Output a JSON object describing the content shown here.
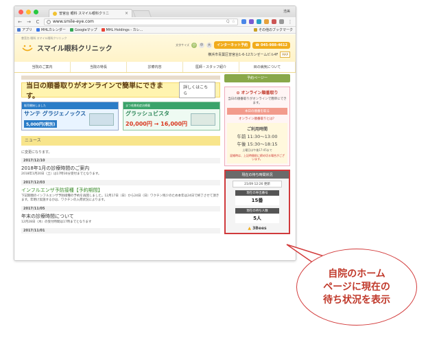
{
  "browser": {
    "tab_title": "曽宮台 眼科 スマイル眼科クリニ",
    "tab_close": "×",
    "profile": "浩美",
    "nav_back": "←",
    "nav_forward": "→",
    "nav_reload": "C",
    "url": "www.smile-eye.com",
    "omni_search": "Q",
    "omni_star": "☆",
    "menu": "⋮",
    "bookmarks": [
      {
        "label": "アプリ",
        "color": "#4a7bd0"
      },
      {
        "label": "MHLカレンダー",
        "color": "#3b78e7"
      },
      {
        "label": "Googleマップ",
        "color": "#34a853"
      },
      {
        "label": "MHL Holdings - カレ...",
        "color": "#ea4335"
      }
    ],
    "other_bookmarks": "その他のブックマーク"
  },
  "site": {
    "breadcrumb": "曽宮台 眼科 スマイル眼科クリニック",
    "clinic_name": "スマイル眼科クリニック",
    "font_size_label": "文字サイズ",
    "font_size_buttons": [
      "小",
      "中",
      "大"
    ],
    "reserve_button": "インターネット予約",
    "phone": "☎ 045-988-4612",
    "address": "横浜市青葉区曽宮台1-6-12カンゼームビル4F",
    "map_button": "MAP",
    "nav": [
      "当院のご案内",
      "当院の特長",
      "診療内容",
      "医師・スタッフ紹介",
      "目の病気について"
    ]
  },
  "main": {
    "banner_title": "当日の順番取りがオンラインで簡単にできます。",
    "banner_button": "詳しくはこちら",
    "promo1": {
      "head": "販売開始しました",
      "name": "サンテ グラジェノックス",
      "price": "5,000円(税別)"
    },
    "promo2": {
      "head": "まつ毛貧毛症治療薬",
      "name": "グラッシュビスタ",
      "price": "20,000円 → 16,000円"
    },
    "news_heading": "ニュース",
    "news_intro": "に変更になります。",
    "news": [
      {
        "date": "2017/12/10",
        "title": "2018年1月の診療時間のご案内",
        "body": "2018年1月20日（土）は17時30分受付までとなります。",
        "highlight": false
      },
      {
        "date": "2017/12/03",
        "title": "インフルエンザ予防接種【予約期間】",
        "body": "下記期間のインフルエンザ予防接種の予約を再開しました。12月17日（日）から24日（日）ワクチン残少のため本年は24日で終了させて頂きます。年明け実施するかは、ワクチンの入荷状況によります。",
        "highlight": true
      },
      {
        "date": "2017/11/05",
        "title": "年末の診療時間について",
        "body": "12月28日（木）の受付時間は17時までとなります",
        "highlight": false
      },
      {
        "date": "2017/11/01",
        "title": "",
        "body": "",
        "highlight": false
      }
    ]
  },
  "sidebar": {
    "top_button": "予約ページ一",
    "online_title": "⊙ オンライン順番取り",
    "online_desc": "当日の順番取りがオンラインで簡単にできます。",
    "online_button": "本日の順番を取る",
    "online_link": "オンライン順番取りとは？",
    "hours_title": "ご利用時間",
    "hours_am": "午前 11:30〜13:00",
    "hours_pm": "午後 15:30〜18:15",
    "hours_note": "土曜日は午後17:45まで",
    "hours_warn": "混雑時は、上記時間前に締め切る場合がございます。",
    "wait_title": "現在の待ち時間状況",
    "wait_time": "21/09 12:26 更新",
    "called_label": "現在の呼出番号",
    "called_value": "15番",
    "waiting_label": "現在の待ち人数",
    "waiting_value": "5人",
    "brand": "3Bees"
  },
  "callout": {
    "lines": [
      "自院のホーム",
      "ページに現在の",
      "待ち状況を表示"
    ]
  }
}
